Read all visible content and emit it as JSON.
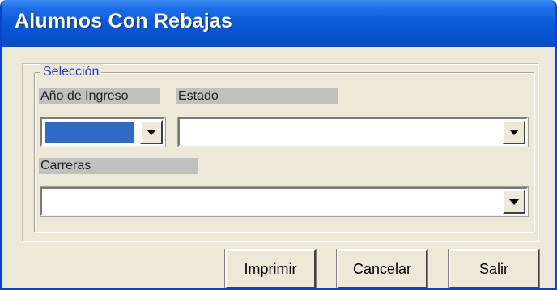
{
  "window": {
    "title": "Alumnos Con Rebajas"
  },
  "seleccion": {
    "legend": "Selección",
    "anio_label": "Año de Ingreso",
    "estado_label": "Estado",
    "carreras_label": "Carreras",
    "anio_value": "",
    "estado_value": "",
    "carreras_value": ""
  },
  "buttons": {
    "imprimir": "Imprimir",
    "cancelar": "Cancelar",
    "salir": "Salir"
  },
  "colors": {
    "titlebar": "#0a58d8",
    "legend_text": "#2038d8",
    "selected_fill": "#316ac5",
    "dialog_bg": "#ece9d8"
  },
  "icons": {
    "dropdown": "chevron-down-icon"
  }
}
